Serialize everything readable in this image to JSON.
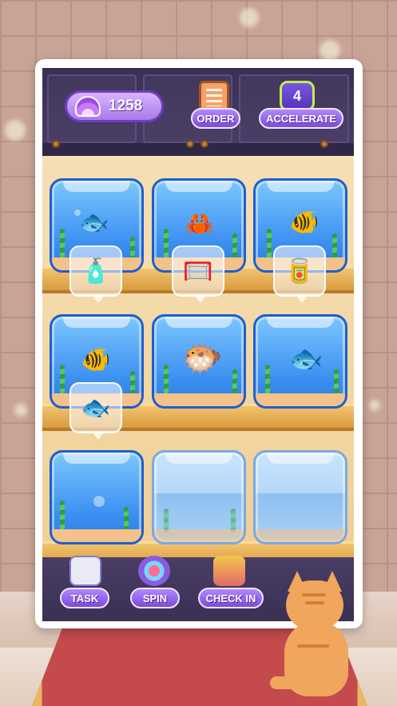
{
  "hud": {
    "shell_icon": "shell-icon",
    "shell_count": "1258",
    "order_label": "ORDER",
    "order_icon": "clipboard-icon",
    "accelerate_label": "ACCELERATE",
    "accelerate_icon": "lightning-icon",
    "accelerate_value": "4"
  },
  "tanks": [
    {
      "row": 1,
      "col": 1,
      "fish": "clownfish-white",
      "glyph": "🐟",
      "filled": true
    },
    {
      "row": 1,
      "col": 2,
      "fish": "crab",
      "glyph": "🦀",
      "filled": true
    },
    {
      "row": 1,
      "col": 3,
      "fish": "goldfish",
      "glyph": "🐠",
      "filled": true
    },
    {
      "row": 2,
      "col": 1,
      "fish": "clownfish",
      "glyph": "🐠",
      "filled": true
    },
    {
      "row": 2,
      "col": 2,
      "fish": "yellow-fish",
      "glyph": "🐡",
      "filled": true
    },
    {
      "row": 2,
      "col": 3,
      "fish": "angelfish",
      "glyph": "🐟",
      "filled": true
    },
    {
      "row": 3,
      "col": 1,
      "fish": "",
      "glyph": "",
      "filled": true
    },
    {
      "row": 3,
      "col": 2,
      "fish": "",
      "glyph": "",
      "filled": false
    },
    {
      "row": 3,
      "col": 3,
      "fish": "",
      "glyph": "",
      "filled": false
    }
  ],
  "requests": [
    {
      "name": "oxygen-bottle-icon",
      "glyph": "🧴"
    },
    {
      "name": "fishing-net-icon",
      "glyph": "🥅"
    },
    {
      "name": "fish-food-icon",
      "glyph": "🥫"
    },
    {
      "name": "blue-fish-icon",
      "glyph": "🐟"
    }
  ],
  "nav": {
    "task_label": "TASK",
    "spin_label": "SPIN",
    "checkin_label": "CHECK IN"
  },
  "colors": {
    "accent_purple": "#7b4bdc",
    "tank_blue": "#3b8ff0",
    "shelf_wood": "#e8b35a",
    "wall": "#c8a497"
  }
}
